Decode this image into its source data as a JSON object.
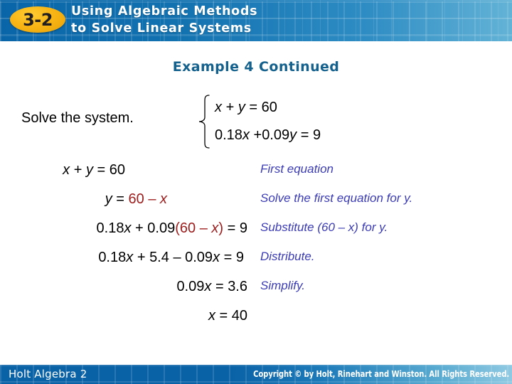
{
  "header": {
    "badge": "3-2",
    "title_line1": "Using Algebraic Methods",
    "title_line2": "to Solve Linear Systems",
    "bg_color": "#0a65a8",
    "badge_color": "#f9b515"
  },
  "slide": {
    "subtitle": "Example 4 Continued",
    "subtitle_color": "#15618d",
    "prompt": "Solve the system.",
    "system": [
      "x + y = 60",
      "0.18x +0.09y = 9"
    ]
  },
  "work": {
    "note_color": "#3b3bb5",
    "highlight_color": "#9d1c1c",
    "rows": [
      {
        "equation": "x + y = 60",
        "note": "First equation"
      },
      {
        "equation": "y = 60 – x",
        "note": "Solve the first equation for y."
      },
      {
        "equation": "0.18x + 0.09(60 – x) = 9",
        "note": "Substitute (60 – x) for y."
      },
      {
        "equation": "0.18x + 5.4 – 0.09x = 9",
        "note": "Distribute."
      },
      {
        "equation": "0.09x = 3.6",
        "note": "Simplify."
      },
      {
        "equation": "x = 40",
        "note": ""
      }
    ]
  },
  "footer": {
    "left": "Holt Algebra 2",
    "right": "Copyright © by Holt, Rinehart and Winston. All Rights Reserved."
  },
  "parts": {
    "x": "x",
    "y": "y",
    "plus": "+",
    "minus": "–",
    "eq": "=",
    "n60": "60",
    "n9": "9",
    "n40": "40",
    "n36": "3.6",
    "n54": "5.4",
    "c018": "0.18",
    "c009": "0.09",
    "lparen": "(",
    "rparen": ")"
  }
}
